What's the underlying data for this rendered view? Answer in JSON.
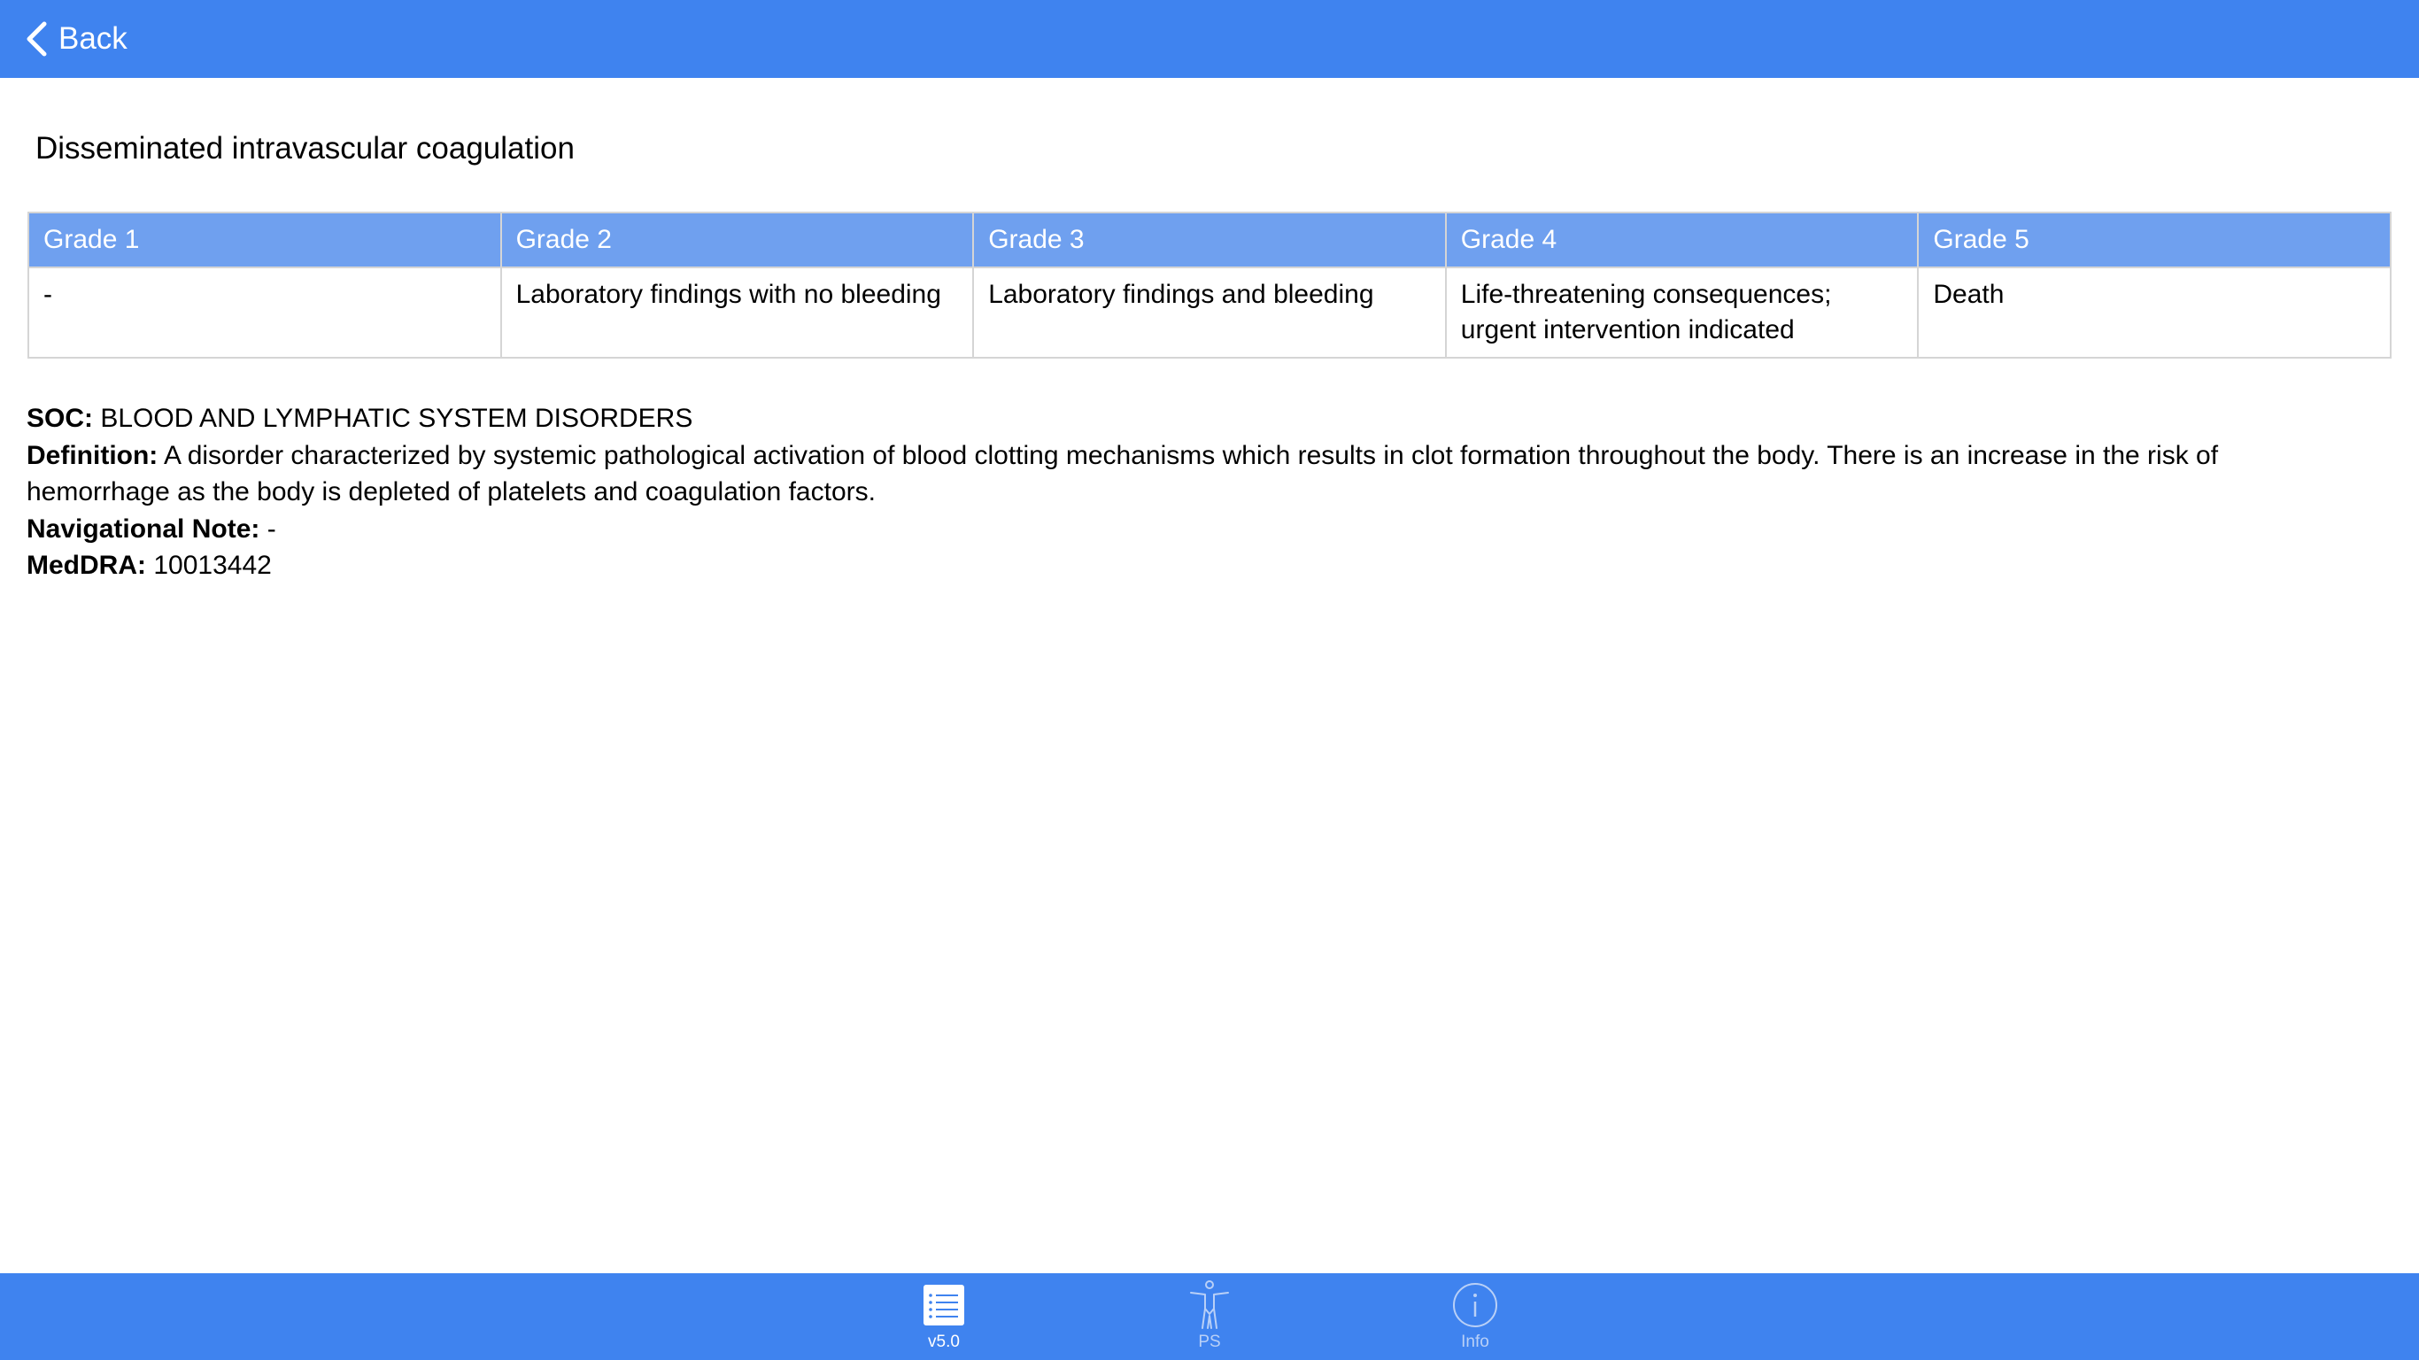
{
  "navbar": {
    "back_label": "Back",
    "back_icon": "chevron-left-icon",
    "color": "#3f83ef"
  },
  "page_title": "Disseminated intravascular coagulation",
  "grade_table": {
    "headers": [
      "Grade 1",
      "Grade 2",
      "Grade 3",
      "Grade 4",
      "Grade 5"
    ],
    "rows": [
      {
        "cells": [
          "-",
          "Laboratory findings with no bleeding",
          "Laboratory findings and bleeding",
          "Life-threatening consequences; urgent intervention indicated",
          "Death"
        ]
      }
    ],
    "header_color": "#6fa0ef"
  },
  "details": {
    "soc_label": "SOC:",
    "soc_value": "BLOOD AND LYMPHATIC SYSTEM DISORDERS",
    "definition_label": "Definition:",
    "definition_value": "A disorder characterized by systemic pathological activation of blood clotting mechanisms which results in clot formation throughout the body. There is an increase in the risk of hemorrhage as the body is depleted of platelets and coagulation factors.",
    "nav_note_label": "Navigational Note:",
    "nav_note_value": "-",
    "meddra_label": "MedDRA:",
    "meddra_value": "10013442"
  },
  "tabbar": {
    "tabs": [
      {
        "label": "v5.0",
        "icon": "list-icon",
        "selected": true
      },
      {
        "label": "PS",
        "icon": "body-figure-icon",
        "selected": false
      },
      {
        "label": "Info",
        "icon": "info-icon",
        "selected": false
      }
    ]
  }
}
